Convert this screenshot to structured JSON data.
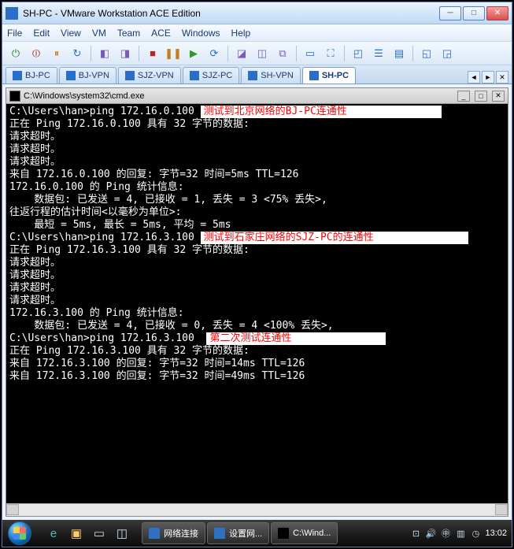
{
  "titlebar": {
    "title": "SH-PC - VMware Workstation ACE Edition"
  },
  "menu": {
    "items": [
      "File",
      "Edit",
      "View",
      "VM",
      "Team",
      "ACE",
      "Windows",
      "Help"
    ]
  },
  "tabs": {
    "items": [
      {
        "label": "BJ-PC"
      },
      {
        "label": "BJ-VPN"
      },
      {
        "label": "SJZ-VPN"
      },
      {
        "label": "SJZ-PC"
      },
      {
        "label": "SH-VPN"
      },
      {
        "label": "SH-PC"
      }
    ],
    "active_index": 5
  },
  "cmd": {
    "title": "C:\\Windows\\system32\\cmd.exe",
    "lines": [
      {
        "t": "C:\\Users\\han>ping 172.16.0.100 ",
        "a": "测试到北京网络的BJ-PC连通性",
        "pad": true
      },
      {
        "t": ""
      },
      {
        "t": "正在 Ping 172.16.0.100 具有 32 字节的数据:"
      },
      {
        "t": "请求超时。"
      },
      {
        "t": "请求超时。"
      },
      {
        "t": "请求超时。"
      },
      {
        "t": "来自 172.16.0.100 的回复: 字节=32 时间=5ms TTL=126"
      },
      {
        "t": ""
      },
      {
        "t": "172.16.0.100 的 Ping 统计信息:"
      },
      {
        "t": "    数据包: 已发送 = 4, 已接收 = 1, 丢失 = 3 <75% 丢失>,"
      },
      {
        "t": "往返行程的估计时间<以毫秒为单位>:"
      },
      {
        "t": "    最短 = 5ms, 最长 = 5ms, 平均 = 5ms"
      },
      {
        "t": ""
      },
      {
        "t": "C:\\Users\\han>ping 172.16.3.100 ",
        "a": "测试到石家庄网络的SJZ-PC的连通性",
        "pad": true
      },
      {
        "t": ""
      },
      {
        "t": "正在 Ping 172.16.3.100 具有 32 字节的数据:"
      },
      {
        "t": "请求超时。"
      },
      {
        "t": "请求超时。"
      },
      {
        "t": "请求超时。"
      },
      {
        "t": "请求超时。"
      },
      {
        "t": ""
      },
      {
        "t": "172.16.3.100 的 Ping 统计信息:"
      },
      {
        "t": "    数据包: 已发送 = 4, 已接收 = 0, 丢失 = 4 <100% 丢失>,"
      },
      {
        "t": ""
      },
      {
        "t": "C:\\Users\\han>ping 172.16.3.100  ",
        "a": "第二次测试连通性",
        "pad": true
      },
      {
        "t": ""
      },
      {
        "t": "正在 Ping 172.16.3.100 具有 32 字节的数据:"
      },
      {
        "t": "来自 172.16.3.100 的回复: 字节=32 时间=14ms TTL=126"
      },
      {
        "t": "来自 172.16.3.100 的回复: 字节=32 时间=49ms TTL=126"
      }
    ]
  },
  "taskbar": {
    "tasks": [
      {
        "label": "网络连接"
      },
      {
        "label": "设置网..."
      },
      {
        "label": "C:\\Wind..."
      }
    ],
    "clock": "13:02"
  }
}
